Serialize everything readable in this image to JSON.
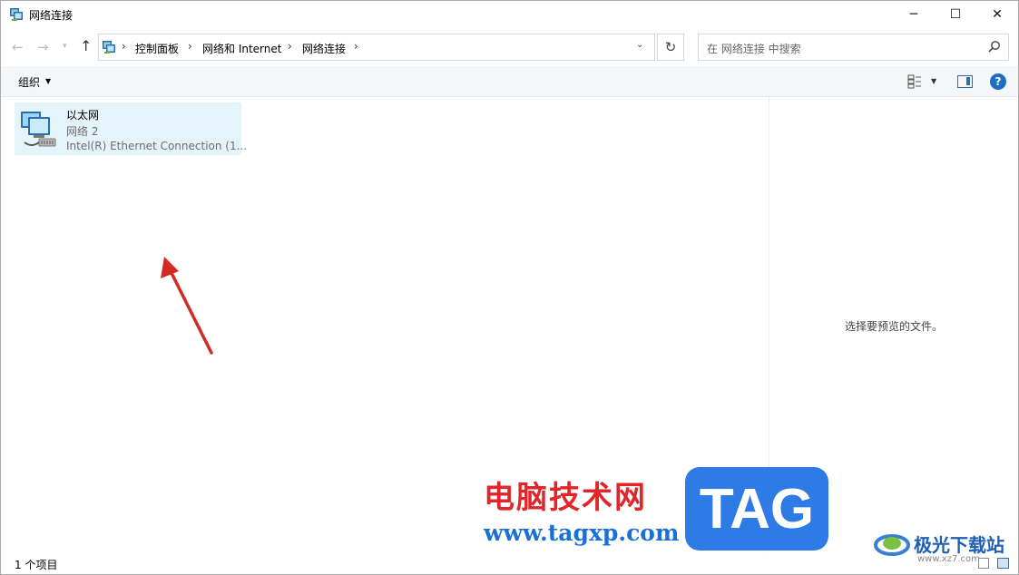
{
  "window": {
    "title": "网络连接",
    "min_icon": "minimize-icon",
    "max_icon": "maximize-icon",
    "close_icon": "close-icon"
  },
  "address": {
    "crumbs": [
      "控制面板",
      "网络和 Internet",
      "网络连接"
    ],
    "separator": "›",
    "search_placeholder": "在 网络连接 中搜索"
  },
  "toolbar": {
    "organize_label": "组织",
    "help_label": "?"
  },
  "items": [
    {
      "name": "以太网",
      "status": "网络 2",
      "device": "Intel(R) Ethernet Connection (1..."
    }
  ],
  "preview": {
    "message": "选择要预览的文件。"
  },
  "status": {
    "count": "1 个项目"
  },
  "watermark": {
    "brand_cn": "电脑技术网",
    "url": "www.tagxp.com",
    "tag": "TAG",
    "site_name": "极光下载站",
    "site_url": "www.xz7.com"
  },
  "colors": {
    "selection": "#e5f3fb",
    "accent": "#1c6ec0",
    "arrow": "#d42a24"
  }
}
